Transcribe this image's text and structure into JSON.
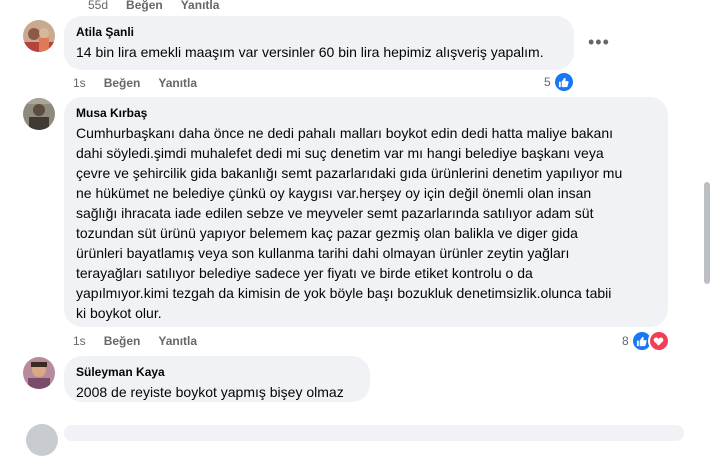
{
  "top_actions": {
    "time": "55d",
    "like": "Beğen",
    "reply": "Yanıtla"
  },
  "comments": [
    {
      "author": "Atila Şanli",
      "text": "14 bin lira emekli maaşım var versinler 60 bin lira hepimiz alışveriş yapalım.",
      "time": "1s",
      "like_label": "Beğen",
      "reply_label": "Yanıtla",
      "reaction_count": "5",
      "reactions": [
        "like"
      ]
    },
    {
      "author": "Musa Kırbaş",
      "lines": [
        "Cumhurbaşkanı daha önce ne dedi pahalı malları boykot edin dedi hatta maliye bakanı",
        "dahi söyledi.şimdi muhalefet dedi mi suç denetim var mı hangi belediye başkanı veya",
        "çevre ve şehircilik gida bakanlığı semt pazarlarıdaki gıda ürünlerini denetim yapılıyor mu",
        "ne hükümet ne belediye çünkü oy kaygısı var.herşey oy için değil önemli olan insan",
        "sağlığı ihracata iade edilen sebze ve meyveler semt pazarlarında satılıyor adam süt",
        "tozundan süt ürünü yapıyor belemem kaç pazar gezmiş olan balikla ve diger gida",
        "ürünleri bayatlamış veya son kullanma tarihi dahi olmayan ürünler zeytin yağları",
        "terayağları satılıyor belediye sadece yer fiyatı ve birde etiket kontrolu o da",
        "yapılmıyor.kimi tezgah da kimisin de yok böyle başı bozukluk denetimsizlik.olunca tabii",
        "ki boykot olur."
      ],
      "time": "1s",
      "like_label": "Beğen",
      "reply_label": "Yanıtla",
      "reaction_count": "8",
      "reactions": [
        "like",
        "love"
      ]
    },
    {
      "author": "Süleyman Kaya",
      "text": "2008 de reyiste boykot yapmış bişey olmaz"
    }
  ],
  "colors": {
    "like": "#1877f2",
    "love": "#f33e58",
    "bubble": "#f0f2f5",
    "meta": "#65676b"
  },
  "icons": [
    "more-options-icon",
    "like-reaction-icon",
    "love-reaction-icon"
  ]
}
